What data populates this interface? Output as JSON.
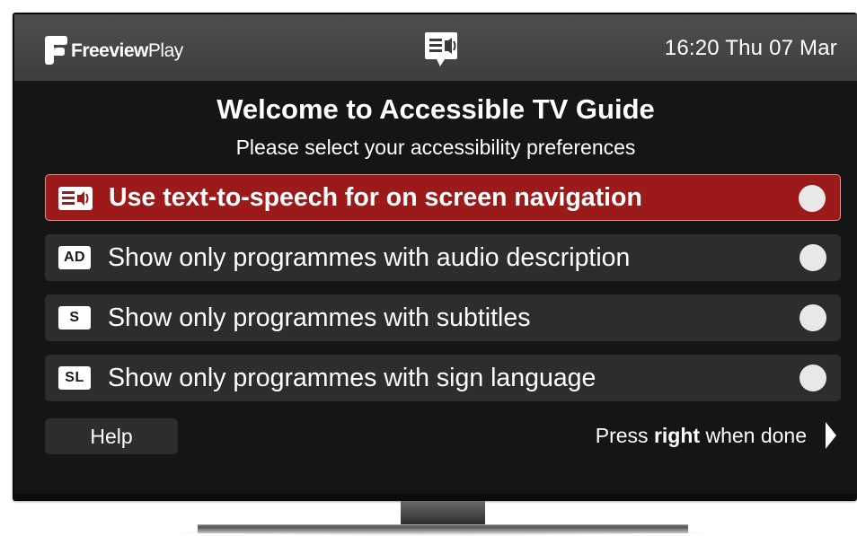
{
  "header": {
    "brand_free": "Freeview",
    "brand_play": "Play",
    "center_icon": "text-to-speech-icon",
    "datetime": "16:20 Thu 07 Mar"
  },
  "main": {
    "title": "Welcome to Accessible TV Guide",
    "subtitle": "Please select your accessibility preferences"
  },
  "options": [
    {
      "icon": "text-to-speech-icon",
      "badge": "",
      "label": "Use text-to-speech for on screen navigation",
      "selected": true,
      "enabled": false
    },
    {
      "icon": "audio-description-icon",
      "badge": "AD",
      "label": "Show only programmes with audio description",
      "selected": false,
      "enabled": false
    },
    {
      "icon": "subtitles-icon",
      "badge": "S",
      "label": "Show only programmes with subtitles",
      "selected": false,
      "enabled": false
    },
    {
      "icon": "sign-language-icon",
      "badge": "SL",
      "label": "Show only programmes with sign language",
      "selected": false,
      "enabled": false
    }
  ],
  "footer": {
    "help_label": "Help",
    "hint_pre": "Press ",
    "hint_bold": "right",
    "hint_post": " when done",
    "arrow_icon": "chevron-right-icon"
  },
  "colors": {
    "selected_row": "#9c1a1a",
    "row": "#2d2d2d",
    "header": "#4a4a4a",
    "background": "#151515"
  }
}
